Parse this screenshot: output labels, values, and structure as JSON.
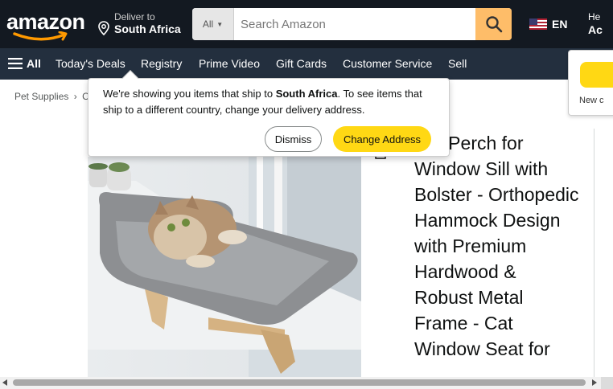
{
  "header": {
    "logo_text": "amazon",
    "deliver_line1": "Deliver to",
    "deliver_line2": "South Africa",
    "search_category": "All",
    "search_placeholder": "Search Amazon",
    "language": "EN",
    "account_line1": "He",
    "account_line2": "Ac"
  },
  "subnav": {
    "all_label": "All",
    "links": [
      "Today's Deals",
      "Registry",
      "Prime Video",
      "Gift Cards",
      "Customer Service",
      "Sell"
    ]
  },
  "signin_flyout": {
    "new_customer_text": "New c"
  },
  "breadcrumb": {
    "item1": "Pet Supplies",
    "sep": "›",
    "item2": "C"
  },
  "popover": {
    "text_before": "We're showing you items that ship to ",
    "country": "South Africa",
    "text_after": ". To see items that ship to a different country, change your delivery address.",
    "dismiss_label": "Dismiss",
    "change_label": "Change Address"
  },
  "product": {
    "title": "Cat Perch for Window Sill with Bolster - Orthopedic Hammock Design with Premium Hardwood & Robust Metal Frame - Cat Window Seat for"
  },
  "colors": {
    "nav_dark": "#131921",
    "nav_sub": "#232f3e",
    "search_button": "#febd69",
    "primary_button": "#ffd814",
    "logo_smile": "#ff9900"
  }
}
